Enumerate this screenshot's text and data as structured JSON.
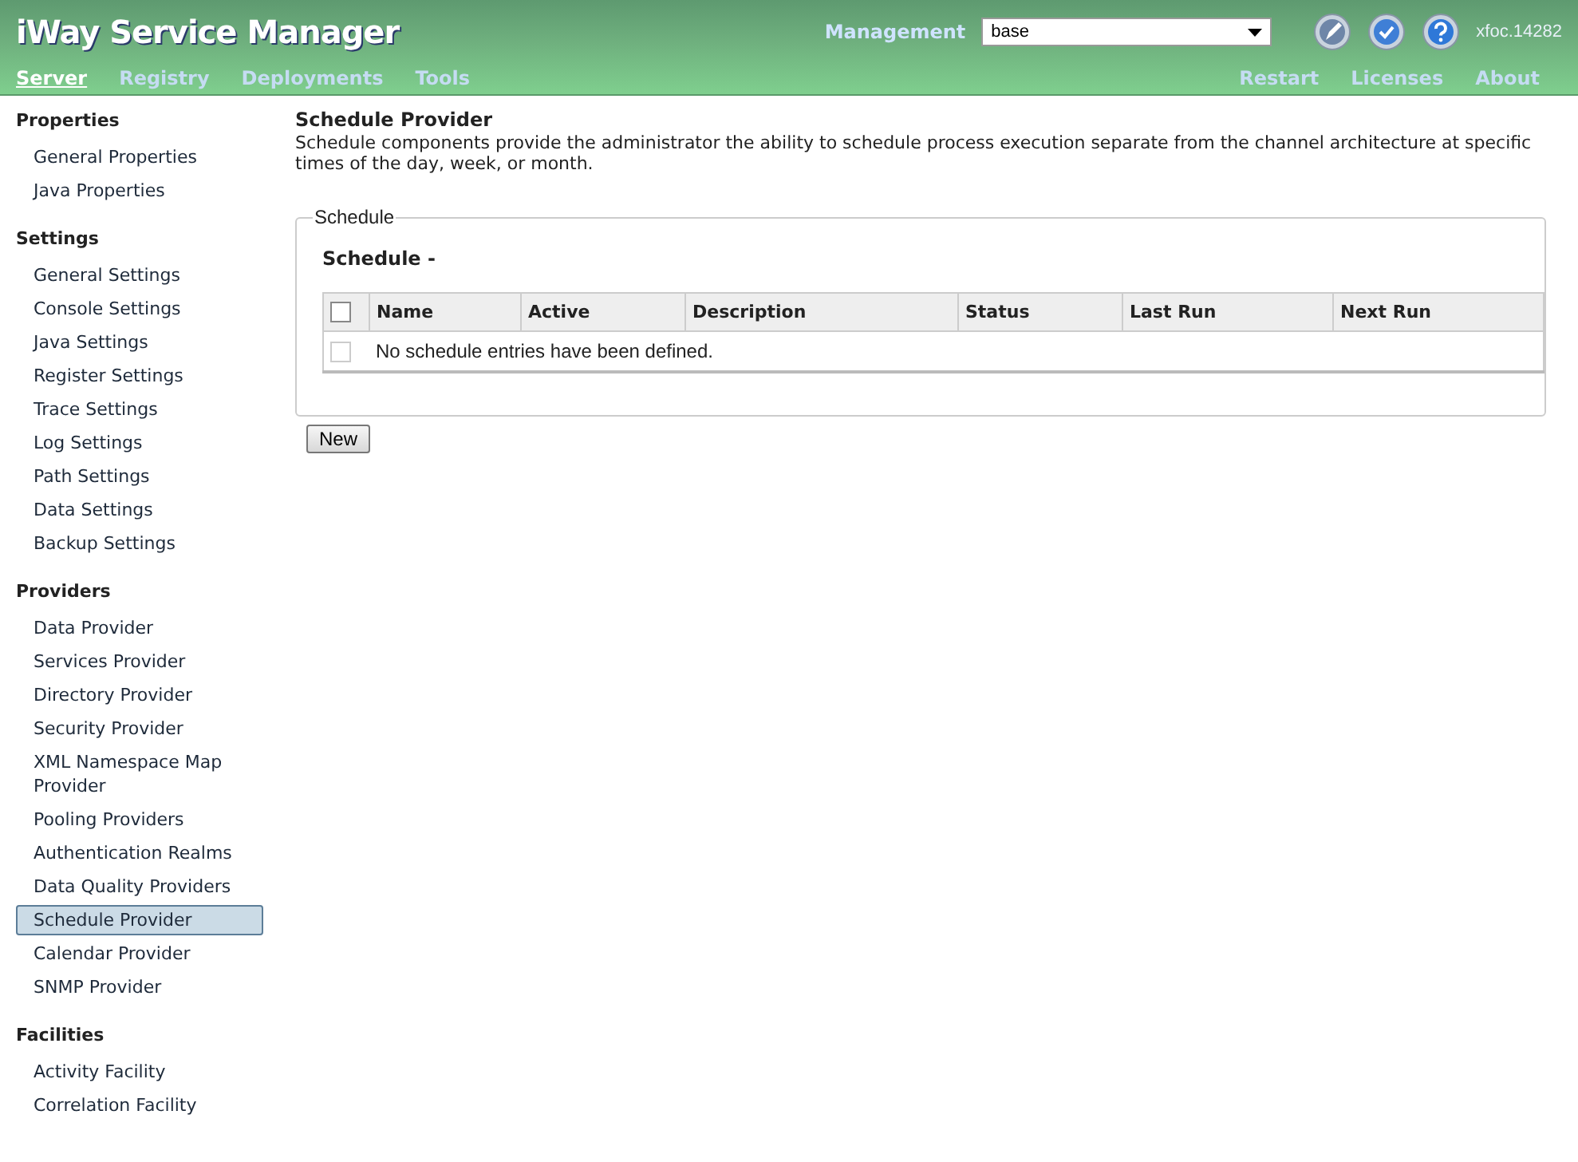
{
  "header": {
    "title": "iWay Service Manager",
    "management_label": "Management",
    "management_value": "base",
    "user": "xfoc.14282"
  },
  "nav_left": [
    {
      "label": "Server",
      "selected": true
    },
    {
      "label": "Registry",
      "selected": false
    },
    {
      "label": "Deployments",
      "selected": false
    },
    {
      "label": "Tools",
      "selected": false
    }
  ],
  "nav_right": [
    "Restart",
    "Licenses",
    "About"
  ],
  "sidebar": [
    {
      "title": "Properties",
      "items": [
        {
          "label": "General Properties",
          "selected": false
        },
        {
          "label": "Java Properties",
          "selected": false
        }
      ]
    },
    {
      "title": "Settings",
      "items": [
        {
          "label": "General Settings",
          "selected": false
        },
        {
          "label": "Console Settings",
          "selected": false
        },
        {
          "label": "Java Settings",
          "selected": false
        },
        {
          "label": "Register Settings",
          "selected": false
        },
        {
          "label": "Trace Settings",
          "selected": false
        },
        {
          "label": "Log Settings",
          "selected": false
        },
        {
          "label": "Path Settings",
          "selected": false
        },
        {
          "label": "Data Settings",
          "selected": false
        },
        {
          "label": "Backup Settings",
          "selected": false
        }
      ]
    },
    {
      "title": "Providers",
      "items": [
        {
          "label": "Data Provider",
          "selected": false
        },
        {
          "label": "Services Provider",
          "selected": false
        },
        {
          "label": "Directory Provider",
          "selected": false
        },
        {
          "label": "Security Provider",
          "selected": false
        },
        {
          "label": "XML Namespace Map Provider",
          "selected": false
        },
        {
          "label": "Pooling Providers",
          "selected": false
        },
        {
          "label": "Authentication Realms",
          "selected": false
        },
        {
          "label": "Data Quality Providers",
          "selected": false
        },
        {
          "label": "Schedule Provider",
          "selected": true
        },
        {
          "label": "Calendar Provider",
          "selected": false
        },
        {
          "label": "SNMP Provider",
          "selected": false
        }
      ]
    },
    {
      "title": "Facilities",
      "items": [
        {
          "label": "Activity Facility",
          "selected": false
        },
        {
          "label": "Correlation Facility",
          "selected": false
        }
      ]
    }
  ],
  "main": {
    "title": "Schedule Provider",
    "description": "Schedule components provide the administrator the ability to schedule process execution separate from the channel architecture at specific times of the day, week, or month.",
    "legend": "Schedule",
    "subtitle": "Schedule -",
    "table": {
      "select_all_checked": false,
      "columns": [
        "Name",
        "Active",
        "Description",
        "Status",
        "Last Run",
        "Next Run"
      ],
      "empty_row": {
        "checked": false,
        "message": "No schedule entries have been defined."
      }
    },
    "button": "New"
  }
}
